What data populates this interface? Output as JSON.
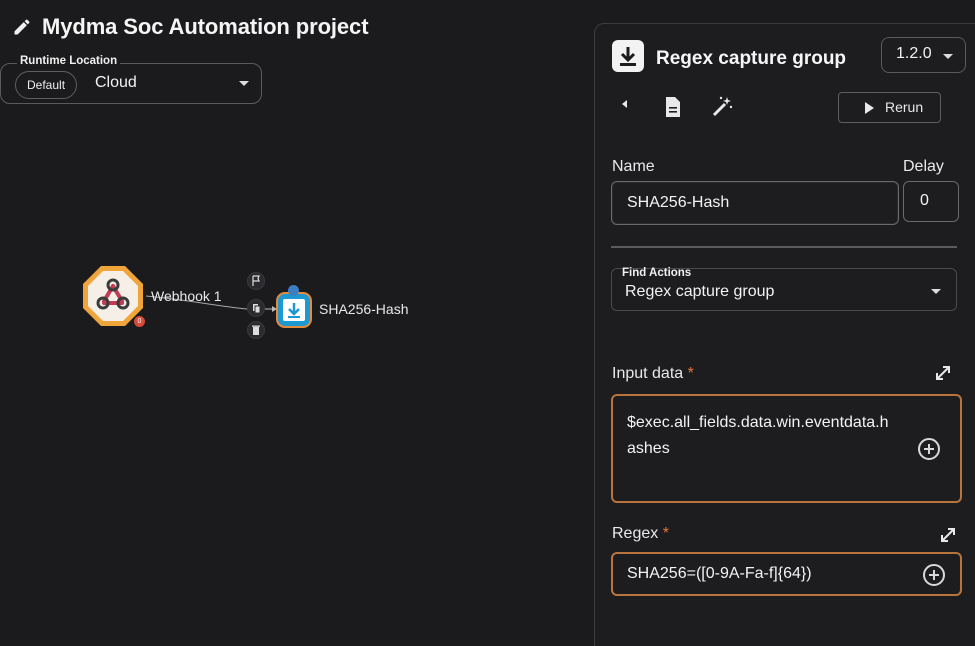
{
  "header": {
    "title": "Mydma Soc Automation project",
    "icon": "pencil-icon"
  },
  "runtime": {
    "legend": "Runtime Location",
    "chip": "Default",
    "value": "Cloud"
  },
  "canvas": {
    "webhook_label": "Webhook 1",
    "webhook_badge": "0",
    "sha_label": "SHA256-Hash"
  },
  "panel": {
    "title": "Regex capture group",
    "version": "1.2.0",
    "rerun_label": "Rerun",
    "name_label": "Name",
    "name_value": "SHA256-Hash",
    "delay_label": "Delay",
    "delay_value": "0",
    "find_actions_label": "Find Actions",
    "find_actions_value": "Regex capture group",
    "input_label": "Input data",
    "input_value_line1": "$exec.all_fields.data.win.eventdata.h",
    "input_value_line2": "ashes",
    "regex_label": "Regex",
    "regex_value": "SHA256=([0-9A-Fa-f]{64})",
    "required_mark": "*"
  },
  "colors": {
    "accent_orange": "#e8743b",
    "node_blue": "#1e98d1",
    "background": "#1b1b1d"
  }
}
